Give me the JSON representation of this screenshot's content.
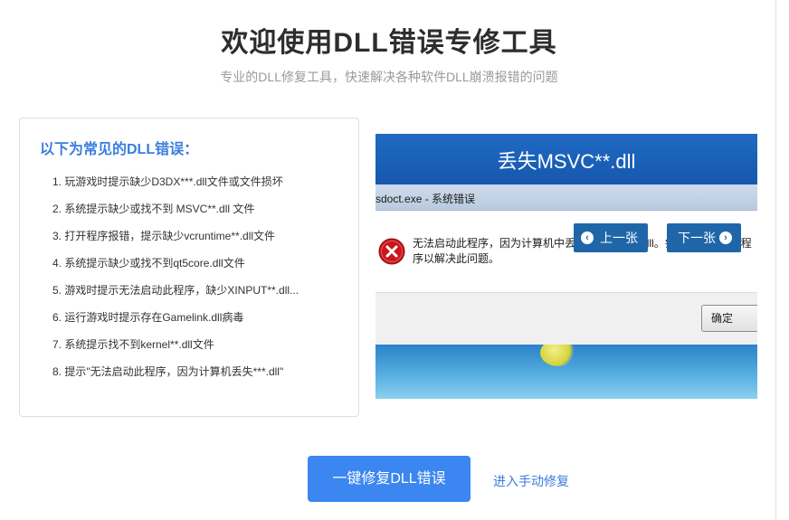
{
  "page": {
    "title": "欢迎使用DLL错误专修工具",
    "subtitle": "专业的DLL修复工具，快速解决各种软件DLL崩溃报错的问题"
  },
  "common_errors": {
    "heading": "以下为常见的DLL错误：",
    "items": [
      "1. 玩游戏时提示缺少D3DX***.dll文件或文件损坏",
      "2. 系统提示缺少或找不到 MSVC**.dll 文件",
      "3. 打开程序报错，提示缺少vcruntime**.dll文件",
      "4. 系统提示缺少或找不到qt5core.dll文件",
      "5. 游戏时提示无法启动此程序，缺少XINPUT**.dll...",
      "6. 运行游戏时提示存在Gamelink.dll病毒",
      "7. 系统提示找不到kernel**.dll文件",
      "8. 提示\"无法启动此程序，因为计算机丢失***.dll\""
    ]
  },
  "slideshow": {
    "banner_title": "丢失MSVC**.dll",
    "dialog_title": "sdoct.exe - 系统错误",
    "error_message": "无法启动此程序，因为计算机中丢失 MSVCP80.dll。尝试重新安装该程序以解决此问题。",
    "ok_label": "确定",
    "prev_label": "上一张",
    "next_label": "下一张"
  },
  "actions": {
    "primary_label": "一键修复DLL错误",
    "manual_label": "进入手动修复"
  },
  "colors": {
    "accent": "#3b86f0",
    "heading_blue": "#3a7de0",
    "banner_blue": "#1658ad",
    "nav_button": "#1f66a8",
    "error_red": "#c8171c"
  }
}
